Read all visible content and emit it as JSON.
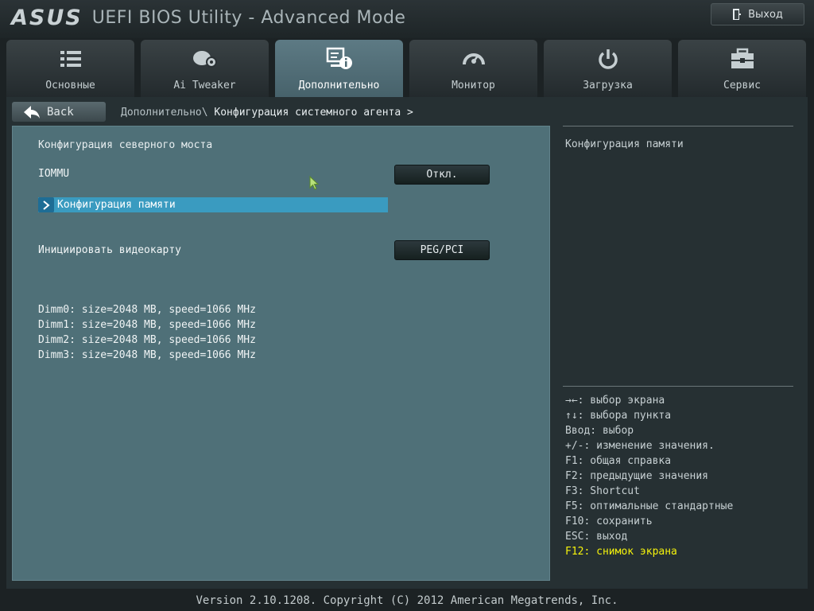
{
  "header": {
    "logo_text": "ASUS",
    "title": "UEFI BIOS Utility - Advanced Mode",
    "exit_label": "Выход"
  },
  "tabs": [
    {
      "label": "Основные",
      "icon": "list-icon",
      "active": false
    },
    {
      "label": "Ai Tweaker",
      "icon": "ai-tweaker-icon",
      "active": false
    },
    {
      "label": "Дополнительно",
      "icon": "advanced-info-icon",
      "active": true
    },
    {
      "label": "Монитор",
      "icon": "gauge-icon",
      "active": false
    },
    {
      "label": "Загрузка",
      "icon": "power-icon",
      "active": false
    },
    {
      "label": "Сервис",
      "icon": "toolbox-icon",
      "active": false
    }
  ],
  "nav": {
    "back_label": "Back",
    "breadcrumb_parent": "Дополнительно\\",
    "breadcrumb_current": "Конфигурация системного агента >"
  },
  "main": {
    "section_title": "Конфигурация северного моста",
    "iommu": {
      "label": "IOMMU",
      "value": "Откл."
    },
    "submenu": {
      "label": "Конфигурация памяти"
    },
    "gpu_init": {
      "label": "Инициировать видеокарту",
      "value": "PEG/PCI"
    },
    "dimms": [
      "Dimm0: size=2048 MB, speed=1066 MHz",
      "Dimm1: size=2048 MB, speed=1066 MHz",
      "Dimm2: size=2048 MB, speed=1066 MHz",
      "Dimm3: size=2048 MB, speed=1066 MHz"
    ]
  },
  "help": {
    "title": "Конфигурация памяти",
    "keys": [
      "→←: выбор экрана",
      "↑↓: выбора пункта",
      "Ввод: выбор",
      "+/-: изменение значения.",
      "F1: общая справка",
      "F2: предыдущие значения",
      "F3: Shortcut",
      "F5: оптимальные стандартные",
      "F10: сохранить",
      "ESC: выход",
      "F12: снимок экрана"
    ]
  },
  "footer": {
    "version": "Version 2.10.1208. Copyright (C) 2012 American Megatrends, Inc."
  },
  "colors": {
    "highlight": "#3a9bc0",
    "panel": "#4f7078",
    "active_tab": "#5d7a84",
    "hotkey_highlight": "#f4f20c"
  }
}
